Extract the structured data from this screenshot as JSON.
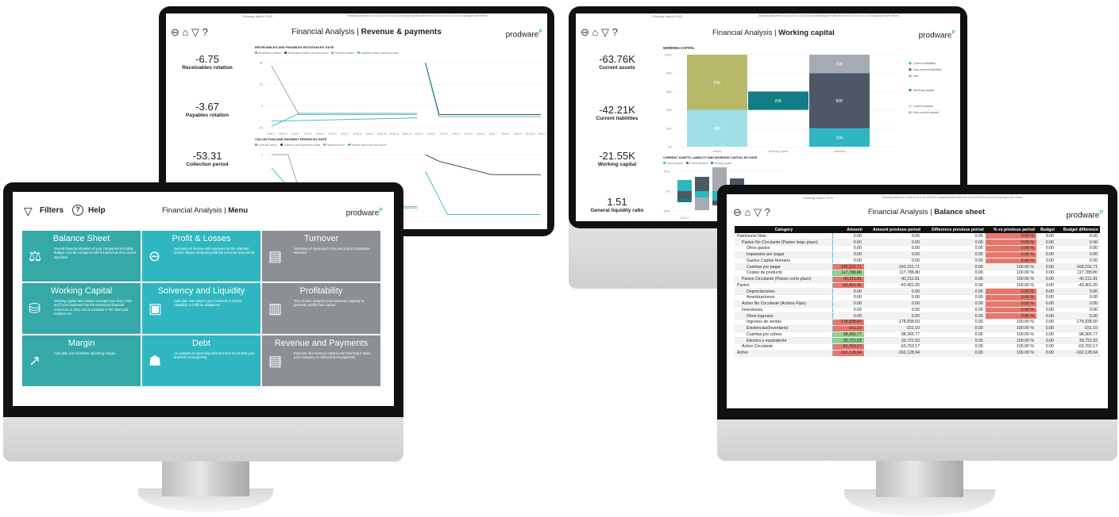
{
  "brand": "prodware",
  "screens": {
    "revenue": {
      "note_left": "Showing data in EUR",
      "note_right": "Showing data from 01/01/2018 to 01/12/2018 comparing with data from 01/01/2018 to 01/12/2018 grouped per meses",
      "title_prefix": "Financial Analysis |",
      "title_bold": "Revenue & payments",
      "kpis": [
        {
          "value": "-6.75",
          "label": "Receivables rotation"
        },
        {
          "value": "-3.67",
          "label": "Payables rotation"
        },
        {
          "value": "-53.31",
          "label": "Collection period"
        }
      ],
      "chart1_title": "RECEIVABLES AND PAYABLES ROTATION BY DATE",
      "chart1_legend": [
        "Receivables rotation",
        "Receivables rotation previous period",
        "Payables rotation",
        "Payables rotation previous period"
      ],
      "chart2_title": "COLLECTION AND PAYMENT PERIOD BY DATE",
      "chart2_legend": [
        "Collection period",
        "Collection period previous period",
        "Payment period",
        "Payment period previous period"
      ],
      "x_ticks": [
        "2018-1",
        "2018-2",
        "2018-3",
        "2018-4",
        "2018-5",
        "2018-6",
        "2018-7",
        "2018-8",
        "2018-9",
        "2018-10",
        "2018-11",
        "2018-12",
        "2019-1",
        "2019-2",
        "2019-3",
        "2019-4",
        "2019-5",
        "2019-6",
        "2019-7",
        "2019-8",
        "2019-9",
        "2019-10",
        "2019-11"
      ],
      "y1_ticks": [
        "40",
        "20",
        "0",
        "-20"
      ],
      "y2_ticks": [
        "0",
        "-20"
      ]
    },
    "working": {
      "note_left": "Showing data in EUR",
      "note_right": "Showing data from 01/01/2018 to 01/12/2018 comparing with data from 01/01/2018 to 01/12/2018 grouped per meses",
      "title_prefix": "Financial Analysis |",
      "title_bold": "Working capital",
      "kpis": [
        {
          "value": "-63.76K",
          "label": "Current assets"
        },
        {
          "value": "-42.21K",
          "label": "Current liabilities"
        },
        {
          "value": "-21.55K",
          "label": "Working capital"
        },
        {
          "value": "1.51",
          "label": "General liquidity ratio"
        }
      ],
      "chart_title": "WORKING CAPITAL",
      "bar_labels": [
        "60K",
        "40K",
        "20K",
        "20K",
        "60K",
        "20K"
      ],
      "categories": [
        "Assets",
        "Working capital",
        "Liabilities"
      ],
      "y_ticks": [
        "100K",
        "80K",
        "60K",
        "40K",
        "20K",
        "0K"
      ],
      "legend": [
        "Current liabilities",
        "Non-current liabilities",
        "Net",
        "Working capital",
        "Current assets",
        "Non-current assets"
      ],
      "chart2_title": "CURRENT ASSETS, LIABILITY AND WORKING CAPITAL BY DATE",
      "chart2_legend": [
        "Current assets",
        "Current liabilities",
        "Working capital"
      ],
      "y2_ticks": [
        "50%",
        "0%",
        "-50%"
      ],
      "x2_ticks": [
        "2018-1"
      ]
    },
    "menu": {
      "filters_label": "Filters",
      "help_label": "Help",
      "title_prefix": "Financial Analysis |",
      "title_bold": "Menu",
      "tiles": [
        {
          "title": "Balance Sheet",
          "desc": "Overall financial situation of your companies including budget. Can be compared with the previous time period specified."
        },
        {
          "title": "Profit & Losses",
          "desc": "Summary of income and expenses for the selected period. Allows comparing with the previous time period."
        },
        {
          "title": "Turnover",
          "desc": "Summary of invoicing for the period and companies selected."
        },
        {
          "title": "Working Capital",
          "desc": "Working capital and related concepts over time. Find out if your business has the necessary financial resources to carry out its activities in the short and medium run."
        },
        {
          "title": "Solvency and Liquidity",
          "desc": "Calculate how solvent your business is and its capability to fulfill its obligations."
        },
        {
          "title": "Profitability",
          "desc": "This section analyzes your business capacity to generate profits from capital."
        },
        {
          "title": "Margin",
          "desc": "Calculate your business operating margin."
        },
        {
          "title": "Debt",
          "desc": "An analysis of upcoming debt and how much debt your business is supporting."
        },
        {
          "title": "Revenue and Payments",
          "desc": "Payment and revenue rotation and how long it takes your company to collect and do payments."
        }
      ]
    },
    "balance": {
      "note_left": "Showing data in EUR",
      "note_right": "Showing data from 01/01/2018 to 01/12/2018 comparing with data from 01/01/2018 to 01/12/2018 grouped per meses",
      "title_prefix": "Financial Analysis |",
      "title_bold": "Balance sheet",
      "columns": [
        "Category",
        "Amount",
        "Amount previous period",
        "Difference previous period",
        "% vs previous period",
        "Budget",
        "Budget difference"
      ],
      "rows": [
        [
          "Patrimonio Neto",
          "0.00",
          "0.00",
          "0.00",
          "0.00 %",
          "0.00",
          "0.00"
        ],
        [
          "Pasivo No Circulante (Pasivo largo plazo)",
          "0.00",
          "0.00",
          "0.00",
          "0.00 %",
          "0.00",
          "0.00"
        ],
        [
          "Otros gastos",
          "0.00",
          "0.00",
          "0.00",
          "0.00 %",
          "0.00",
          "0.00"
        ],
        [
          "Impuestos por pagar",
          "0.00",
          "0.00",
          "0.00",
          "0.00 %",
          "0.00",
          "0.00"
        ],
        [
          "Gastos Capital Humano",
          "0.00",
          "0.00",
          "0.00",
          "0.00 %",
          "0.00",
          "0.00"
        ],
        [
          "Cuentas por pagar",
          "-160,151.71",
          "-160,151.71",
          "0.00",
          "100.00 %",
          "0.00",
          "-160,151.71"
        ],
        [
          "Costes de producto",
          "117,788.80",
          "117,788.80",
          "0.00",
          "100.00 %",
          "0.00",
          "117,788.80"
        ],
        [
          "Pasivo Circulante (Pasivo corto plazo)",
          "-42,211.81",
          "-42,211.81",
          "0.00",
          "100.00 %",
          "0.00",
          "-42,211.81"
        ],
        [
          "Pasivo",
          "-43,401.05",
          "-43,401.05",
          "0.00",
          "100.00 %",
          "0.00",
          "-43,401.05"
        ],
        [
          "Depreciaciones",
          "0.00",
          "0.00",
          "0.00",
          "0.00 %",
          "0.00",
          "0.00"
        ],
        [
          "Amortizaciones",
          "0.00",
          "0.00",
          "0.00",
          "0.00 %",
          "0.00",
          "0.00"
        ],
        [
          "Activo No Circulante (Activos Fijos)",
          "0.00",
          "0.00",
          "0.00",
          "0.00 %",
          "0.00",
          "0.00"
        ],
        [
          "Inversiones",
          "0.00",
          "0.00",
          "0.00",
          "0.00 %",
          "0.00",
          "0.00"
        ],
        [
          "Otros ingresos",
          "0.00",
          "0.00",
          "0.00",
          "0.00 %",
          "0.00",
          "0.00"
        ],
        [
          "Ingresos de ventas",
          "-178,838.60",
          "-178,838.60",
          "0.00",
          "100.00 %",
          "0.00",
          "-178,838.60"
        ],
        [
          "Existencias(Inventario)",
          "-151.10",
          "-151.10",
          "0.00",
          "100.00 %",
          "0.00",
          "-151.10"
        ],
        [
          "Cuentas por cobrar",
          "98,365.77",
          "98,365.77",
          "0.00",
          "100.00 %",
          "0.00",
          "98,365.77"
        ],
        [
          "Efectivo y equivalente",
          "33,721.52",
          "33,721.52",
          "0.00",
          "100.00 %",
          "0.00",
          "33,721.52"
        ],
        [
          "Activo Circulante",
          "-63,763.17",
          "-63,763.17",
          "0.00",
          "100.00 %",
          "0.00",
          "-63,763.17"
        ],
        [
          "Activo",
          "-162,128.94",
          "-162,128.94",
          "0.00",
          "100.00 %",
          "0.00",
          "-162,128.94"
        ]
      ],
      "indent": [
        0,
        1,
        2,
        2,
        2,
        2,
        2,
        1,
        0,
        2,
        2,
        1,
        1,
        2,
        2,
        2,
        2,
        2,
        1,
        0
      ],
      "amount_color": [
        "",
        "",
        "",
        "",
        "",
        "red",
        "green",
        "red",
        "red",
        "",
        "",
        "",
        "",
        "",
        "red",
        "red",
        "green",
        "green",
        "red",
        "red"
      ],
      "pct_color": [
        "red",
        "red",
        "red",
        "red",
        "red",
        "",
        "",
        "",
        "",
        "red",
        "red",
        "red",
        "red",
        "red",
        "",
        "",
        "",
        "",
        "",
        ""
      ]
    }
  },
  "colors": {
    "teal": "#2fb6c0",
    "dark": "#4d5766",
    "olive": "#b8b86a",
    "lightblue": "#9fe0e8",
    "gray": "#8c9095",
    "wc": "#0f7f85"
  }
}
